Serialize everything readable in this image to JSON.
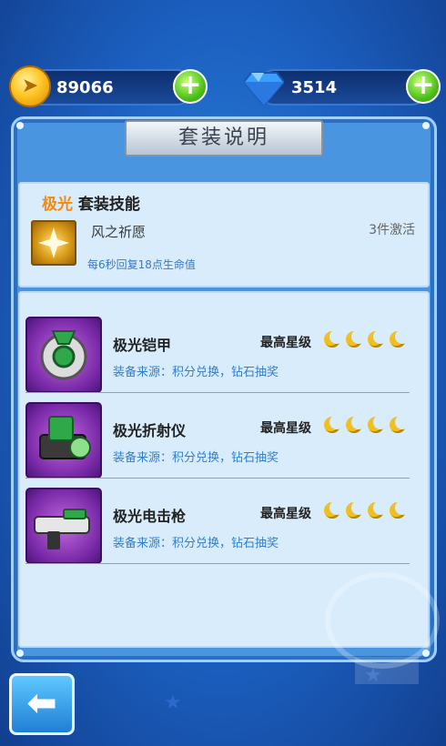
{
  "currency": {
    "coins": "89066",
    "gems": "3514"
  },
  "panel_title": "套装说明",
  "skill": {
    "set_name": "极光",
    "header_suffix": "套装技能",
    "name": "风之祈愿",
    "condition": "3件激活",
    "description": "每6秒回复18点生命值"
  },
  "items": [
    {
      "name": "极光铠甲",
      "max_star_label": "最高星级",
      "source": "装备来源：积分兑换，钻石抽奖",
      "stars": 4
    },
    {
      "name": "极光折射仪",
      "max_star_label": "最高星级",
      "source": "装备来源：积分兑换，钻石抽奖",
      "stars": 4
    },
    {
      "name": "极光电击枪",
      "max_star_label": "最高星级",
      "source": "装备来源：积分兑换，钻石抽奖",
      "stars": 4
    }
  ],
  "colors": {
    "accent_orange": "#f08a10",
    "source_blue": "#2e7fd0",
    "panel_blue": "#4a95e0"
  },
  "icons": {
    "coin": "gold-coin-icon",
    "gem": "blue-diamond-icon",
    "add": "plus-icon",
    "back": "back-arrow-icon",
    "star": "crescent-moon-icon"
  }
}
